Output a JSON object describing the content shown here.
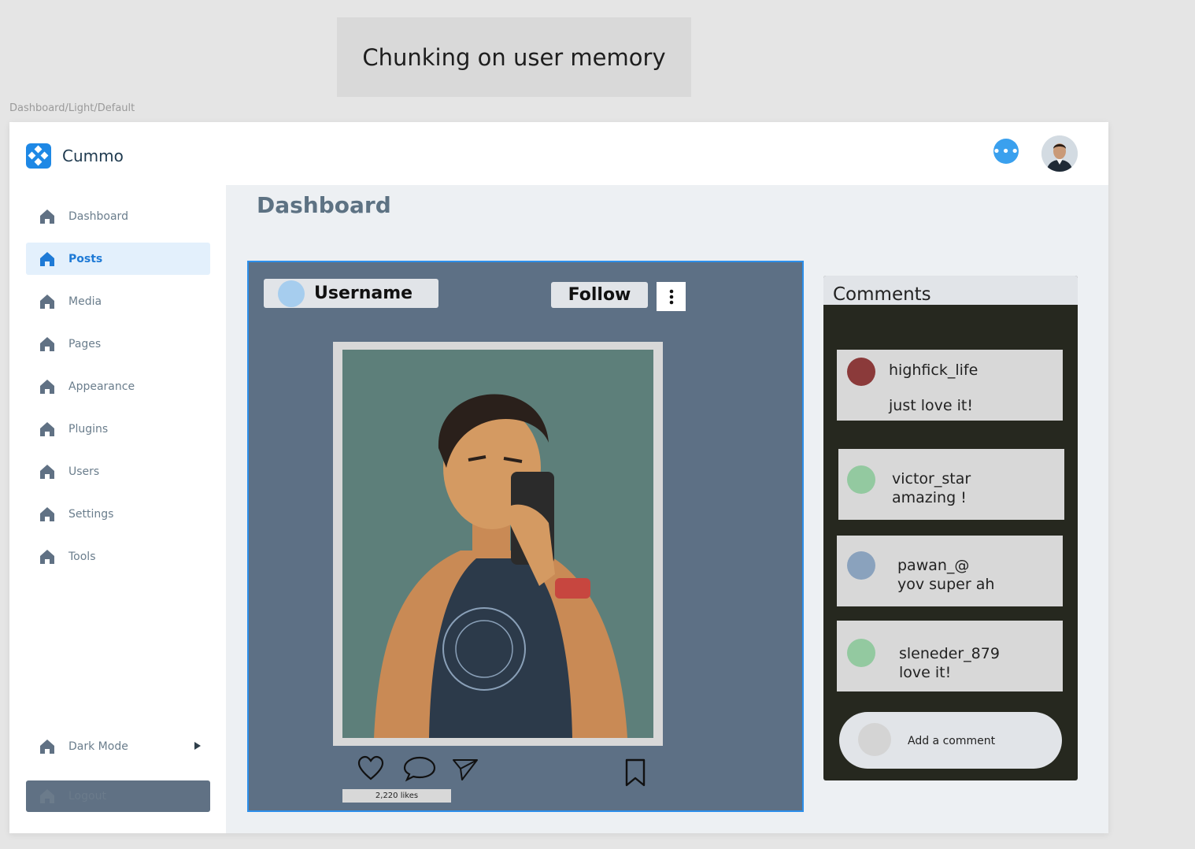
{
  "note": {
    "text": "Chunking on user memory"
  },
  "frame_label": "Dashboard/Light/Default",
  "brand": {
    "name": "Cummo",
    "icon": "brand-logo-icon",
    "accent": "#1e88e5"
  },
  "sidebar": {
    "items": [
      {
        "label": "Dashboard",
        "icon": "home-icon",
        "active": false
      },
      {
        "label": "Posts",
        "icon": "home-icon",
        "active": true
      },
      {
        "label": "Media",
        "icon": "home-icon",
        "active": false
      },
      {
        "label": "Pages",
        "icon": "home-icon",
        "active": false
      },
      {
        "label": "Appearance",
        "icon": "home-icon",
        "active": false
      },
      {
        "label": "Plugins",
        "icon": "home-icon",
        "active": false
      },
      {
        "label": "Users",
        "icon": "home-icon",
        "active": false
      },
      {
        "label": "Settings",
        "icon": "home-icon",
        "active": false
      },
      {
        "label": "Tools",
        "icon": "home-icon",
        "active": false
      }
    ],
    "dark_mode_label": "Dark Mode",
    "logout_label": "Logout"
  },
  "header": {
    "chat_icon": "chat-bubble-icon",
    "avatar": "user-avatar"
  },
  "page": {
    "title": "Dashboard"
  },
  "post": {
    "username": "Username",
    "follow_label": "Follow",
    "likes": "2,220 likes",
    "icons": [
      "heart-icon",
      "comment-icon",
      "send-icon",
      "bookmark-icon",
      "more-vertical-icon"
    ]
  },
  "comments": {
    "title": "Comments",
    "items": [
      {
        "user": "highfick_life",
        "text": "just love it!",
        "color": "#8b3a3a"
      },
      {
        "user": "victor_star",
        "text": "amazing !",
        "color": "#93c9a0"
      },
      {
        "user": "pawan_@",
        "text": "yov super ah",
        "color": "#8aa2bd"
      },
      {
        "user": "sleneder_879",
        "text": "love it!",
        "color": "#93c9a0"
      }
    ],
    "add_placeholder": "Add a comment"
  }
}
